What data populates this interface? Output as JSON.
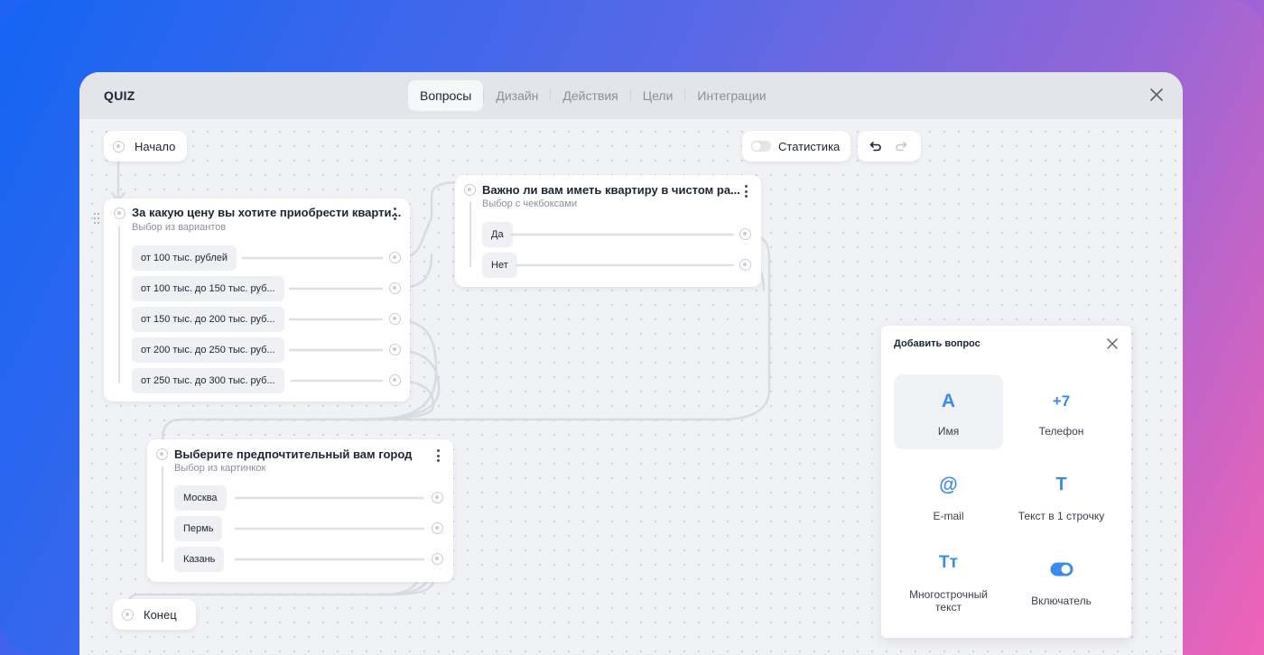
{
  "app": {
    "title": "QUIZ"
  },
  "tabs": [
    {
      "label": "Вопросы",
      "active": true
    },
    {
      "label": "Дизайн",
      "active": false
    },
    {
      "label": "Действия",
      "active": false
    },
    {
      "label": "Цели",
      "active": false
    },
    {
      "label": "Интеграции",
      "active": false
    }
  ],
  "toolbar": {
    "stats_label": "Статистика",
    "stats_enabled": false
  },
  "start_node": {
    "label": "Начало"
  },
  "end_node": {
    "label": "Конец"
  },
  "questions": [
    {
      "title": "За какую цену вы хотите приобрести кварти...",
      "subtitle": "Выбор из вариантов",
      "options": [
        "от 100 тыс. рублей",
        "от 100 тыс. до 150 тыс. руб...",
        "от 150 тыс. до 200 тыс. руб...",
        "от 200 тыс. до 250 тыс. руб...",
        "от 250 тыс. до 300 тыс. руб..."
      ]
    },
    {
      "title": "Важно ли вам иметь квартиру в чистом ра...",
      "subtitle": "Выбор с чекбоксами",
      "options": [
        "Да",
        "Нет"
      ]
    },
    {
      "title": "Выберите предпочтительный вам город",
      "subtitle": "Выбор из картинкок",
      "options": [
        "Москва",
        "Пермь",
        "Казань"
      ]
    }
  ],
  "add_panel": {
    "title": "Добавить вопрос",
    "items": [
      {
        "icon": "A",
        "label": "Имя",
        "icon_name": "name-icon",
        "selected": true
      },
      {
        "icon": "+7",
        "label": "Телефон",
        "icon_name": "phone-icon",
        "selected": false
      },
      {
        "icon": "@",
        "label": "E-mail",
        "icon_name": "email-icon",
        "selected": false
      },
      {
        "icon": "T",
        "label": "Текст в 1 строчку",
        "icon_name": "single-line-text-icon",
        "selected": false
      },
      {
        "icon": "Тт",
        "label": "Многострочный текст",
        "icon_name": "multiline-text-icon",
        "selected": false
      },
      {
        "icon": "",
        "label": "Включатель",
        "icon_name": "toggle-icon",
        "selected": false
      }
    ]
  },
  "colors": {
    "accent": "#3a8bea",
    "wire": "#d8dbe2"
  }
}
